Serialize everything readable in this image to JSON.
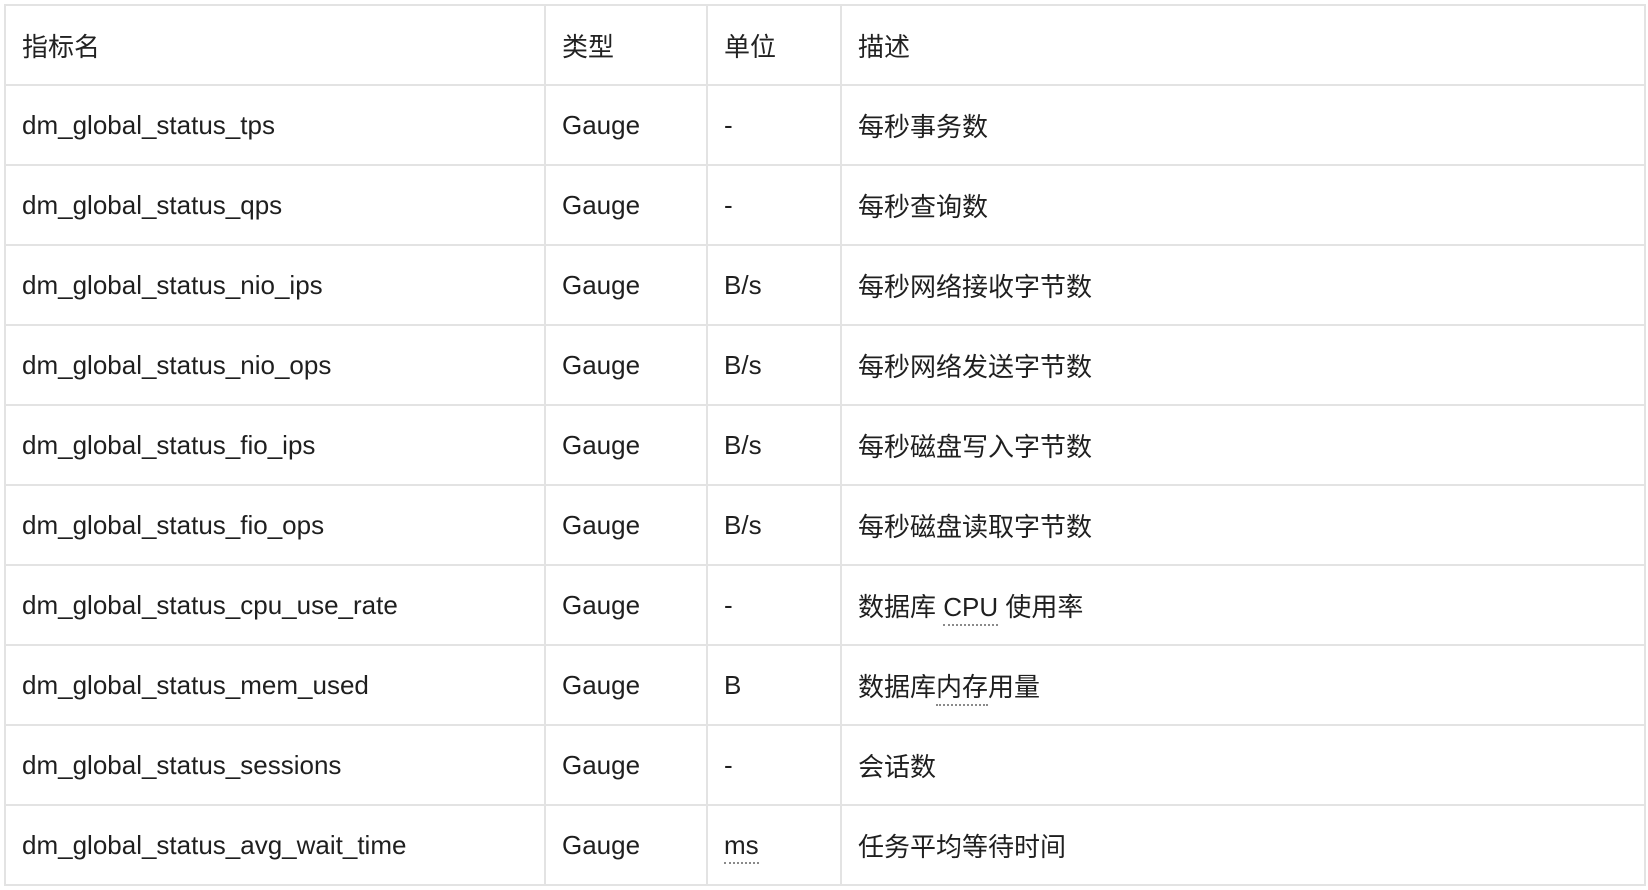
{
  "table": {
    "headers": [
      "指标名",
      "类型",
      "单位",
      "描述"
    ],
    "rows": [
      {
        "name": "dm_global_status_tps",
        "type": "Gauge",
        "unit": "-",
        "desc": "每秒事务数"
      },
      {
        "name": "dm_global_status_qps",
        "type": "Gauge",
        "unit": "-",
        "desc": "每秒查询数"
      },
      {
        "name": "dm_global_status_nio_ips",
        "type": "Gauge",
        "unit": "B/s",
        "desc": "每秒网络接收字节数"
      },
      {
        "name": "dm_global_status_nio_ops",
        "type": "Gauge",
        "unit": "B/s",
        "desc": "每秒网络发送字节数"
      },
      {
        "name": "dm_global_status_fio_ips",
        "type": "Gauge",
        "unit": "B/s",
        "desc": "每秒磁盘写入字节数"
      },
      {
        "name": "dm_global_status_fio_ops",
        "type": "Gauge",
        "unit": "B/s",
        "desc": "每秒磁盘读取字节数"
      },
      {
        "name": "dm_global_status_cpu_use_rate",
        "type": "Gauge",
        "unit": "-",
        "desc_pre": "数据库 ",
        "desc_abbr": "CPU",
        "desc_post": " 使用率"
      },
      {
        "name": "dm_global_status_mem_used",
        "type": "Gauge",
        "unit": "B",
        "desc_pre": "数据库",
        "desc_abbr": "内存",
        "desc_post": "用量"
      },
      {
        "name": "dm_global_status_sessions",
        "type": "Gauge",
        "unit": "-",
        "desc": "会话数"
      },
      {
        "name": "dm_global_status_avg_wait_time",
        "type": "Gauge",
        "unit_abbr": "ms",
        "desc": "任务平均等待时间"
      }
    ]
  }
}
